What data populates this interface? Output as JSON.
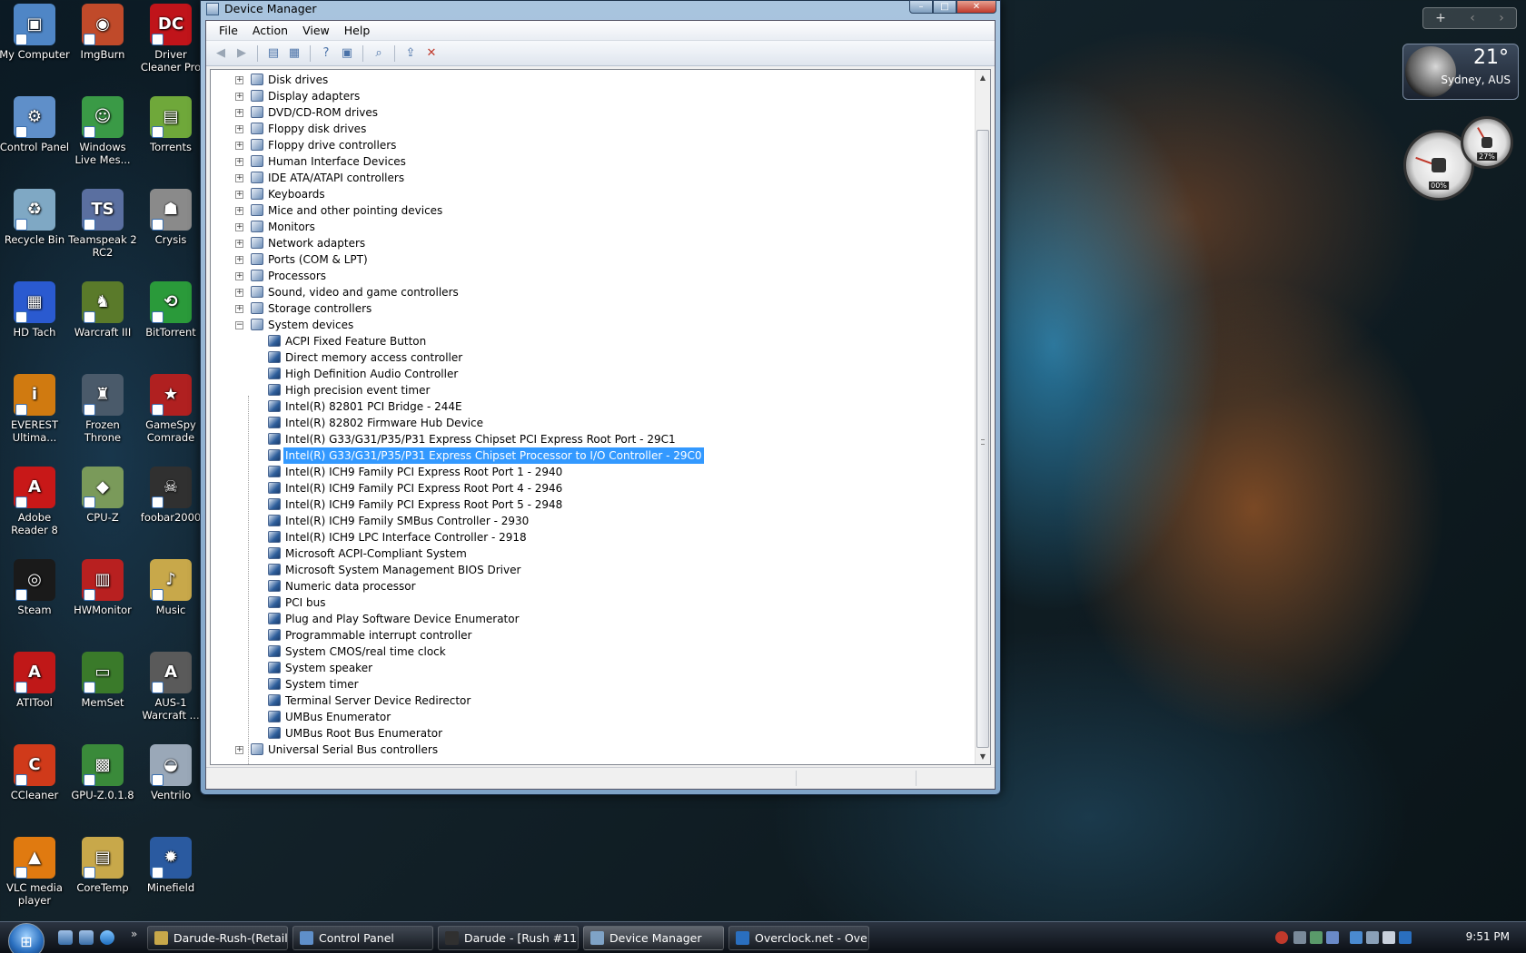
{
  "desktop_icons": [
    {
      "label": "My Computer",
      "color": "#4f86c6",
      "glyph": "▣"
    },
    {
      "label": "ImgBurn",
      "color": "#c04a2a",
      "glyph": "◉"
    },
    {
      "label": "Driver Cleaner Pro",
      "color": "#c0141a",
      "glyph": "DC"
    },
    {
      "label": "Control Panel",
      "color": "#5f8fc9",
      "glyph": "⚙"
    },
    {
      "label": "Windows Live Mes...",
      "color": "#3a9a46",
      "glyph": "☺"
    },
    {
      "label": "Torrents",
      "color": "#6fa83a",
      "glyph": "▤"
    },
    {
      "label": "Recycle Bin",
      "color": "#7fa8c4",
      "glyph": "♻"
    },
    {
      "label": "Teamspeak 2 RC2",
      "color": "#5a6fa0",
      "glyph": "TS"
    },
    {
      "label": "Crysis",
      "color": "#8a8a8a",
      "glyph": "☗"
    },
    {
      "label": "HD Tach",
      "color": "#2a5ad0",
      "glyph": "▦"
    },
    {
      "label": "Warcraft III",
      "color": "#5a7a2a",
      "glyph": "♞"
    },
    {
      "label": "BitTorrent",
      "color": "#2a9a3a",
      "glyph": "⟲"
    },
    {
      "label": "EVEREST Ultima...",
      "color": "#d07a10",
      "glyph": "i"
    },
    {
      "label": "Frozen Throne",
      "color": "#4a5a6a",
      "glyph": "♜"
    },
    {
      "label": "GameSpy Comrade",
      "color": "#b02020",
      "glyph": "★"
    },
    {
      "label": "Adobe Reader 8",
      "color": "#c81818",
      "glyph": "A"
    },
    {
      "label": "CPU-Z",
      "color": "#7a9a5a",
      "glyph": "◆"
    },
    {
      "label": "foobar2000",
      "color": "#303030",
      "glyph": "☠"
    },
    {
      "label": "Steam",
      "color": "#1a1a1a",
      "glyph": "◎"
    },
    {
      "label": "HWMonitor",
      "color": "#b82020",
      "glyph": "▥"
    },
    {
      "label": "Music",
      "color": "#c8a84a",
      "glyph": "♪"
    },
    {
      "label": "ATITool",
      "color": "#c01818",
      "glyph": "A"
    },
    {
      "label": "MemSet",
      "color": "#3a7a2a",
      "glyph": "▭"
    },
    {
      "label": "AUS-1 Warcraft ...",
      "color": "#5a5a5a",
      "glyph": "A"
    },
    {
      "label": "CCleaner",
      "color": "#d03a1a",
      "glyph": "C"
    },
    {
      "label": "GPU-Z.0.1.8",
      "color": "#3a8a3a",
      "glyph": "▩"
    },
    {
      "label": "Ventrilo",
      "color": "#9aa8b8",
      "glyph": "◒"
    },
    {
      "label": "VLC media player",
      "color": "#e07a10",
      "glyph": "▲"
    },
    {
      "label": "CoreTemp",
      "color": "#c8a84a",
      "glyph": "▤"
    },
    {
      "label": "Minefield",
      "color": "#2a5aa0",
      "glyph": "✹"
    }
  ],
  "window": {
    "title": "Device Manager",
    "menu": [
      "File",
      "Action",
      "View",
      "Help"
    ],
    "toolbar_icons": [
      "back-icon",
      "forward-icon",
      "show-hide-console-tree-icon",
      "properties-icon",
      "help-icon",
      "action-pane-icon",
      "scan-hardware-icon",
      "update-driver-icon",
      "uninstall-icon"
    ],
    "tree": [
      {
        "label": "Disk drives",
        "level": 1,
        "expander": "+"
      },
      {
        "label": "Display adapters",
        "level": 1,
        "expander": "+"
      },
      {
        "label": "DVD/CD-ROM drives",
        "level": 1,
        "expander": "+"
      },
      {
        "label": "Floppy disk drives",
        "level": 1,
        "expander": "+"
      },
      {
        "label": "Floppy drive controllers",
        "level": 1,
        "expander": "+"
      },
      {
        "label": "Human Interface Devices",
        "level": 1,
        "expander": "+"
      },
      {
        "label": "IDE ATA/ATAPI controllers",
        "level": 1,
        "expander": "+"
      },
      {
        "label": "Keyboards",
        "level": 1,
        "expander": "+"
      },
      {
        "label": "Mice and other pointing devices",
        "level": 1,
        "expander": "+"
      },
      {
        "label": "Monitors",
        "level": 1,
        "expander": "+"
      },
      {
        "label": "Network adapters",
        "level": 1,
        "expander": "+"
      },
      {
        "label": "Ports (COM & LPT)",
        "level": 1,
        "expander": "+"
      },
      {
        "label": "Processors",
        "level": 1,
        "expander": "+"
      },
      {
        "label": "Sound, video and game controllers",
        "level": 1,
        "expander": "+"
      },
      {
        "label": "Storage controllers",
        "level": 1,
        "expander": "+"
      },
      {
        "label": "System devices",
        "level": 1,
        "expander": "−"
      },
      {
        "label": "ACPI Fixed Feature Button",
        "level": 2
      },
      {
        "label": "Direct memory access controller",
        "level": 2
      },
      {
        "label": "High Definition Audio Controller",
        "level": 2
      },
      {
        "label": "High precision event timer",
        "level": 2
      },
      {
        "label": "Intel(R) 82801 PCI Bridge - 244E",
        "level": 2
      },
      {
        "label": "Intel(R) 82802 Firmware Hub Device",
        "level": 2
      },
      {
        "label": "Intel(R) G33/G31/P35/P31 Express Chipset PCI Express Root Port - 29C1",
        "level": 2
      },
      {
        "label": "Intel(R) G33/G31/P35/P31 Express Chipset Processor to I/O Controller - 29C0",
        "level": 2,
        "selected": true
      },
      {
        "label": "Intel(R) ICH9 Family PCI Express Root Port 1 - 2940",
        "level": 2
      },
      {
        "label": "Intel(R) ICH9 Family PCI Express Root Port 4 - 2946",
        "level": 2
      },
      {
        "label": "Intel(R) ICH9 Family PCI Express Root Port 5 - 2948",
        "level": 2
      },
      {
        "label": "Intel(R) ICH9 Family SMBus Controller - 2930",
        "level": 2
      },
      {
        "label": "Intel(R) ICH9 LPC Interface Controller - 2918",
        "level": 2
      },
      {
        "label": "Microsoft ACPI-Compliant System",
        "level": 2
      },
      {
        "label": "Microsoft System Management BIOS Driver",
        "level": 2
      },
      {
        "label": "Numeric data processor",
        "level": 2
      },
      {
        "label": "PCI bus",
        "level": 2
      },
      {
        "label": "Plug and Play Software Device Enumerator",
        "level": 2
      },
      {
        "label": "Programmable interrupt controller",
        "level": 2
      },
      {
        "label": "System CMOS/real time clock",
        "level": 2
      },
      {
        "label": "System speaker",
        "level": 2
      },
      {
        "label": "System timer",
        "level": 2
      },
      {
        "label": "Terminal Server Device Redirector",
        "level": 2
      },
      {
        "label": "UMBus Enumerator",
        "level": 2
      },
      {
        "label": "UMBus Root Bus Enumerator",
        "level": 2
      },
      {
        "label": "Universal Serial Bus controllers",
        "level": 1,
        "expander": "+"
      }
    ]
  },
  "gadgets": {
    "weather": {
      "temp": "21°",
      "city": "Sydney, AUS"
    },
    "cpu_meter": {
      "cpu": "00%",
      "ram": "27%"
    }
  },
  "taskbar": {
    "buttons": [
      {
        "label": "Darude-Rush-(Retail...",
        "color": "#c8a84a"
      },
      {
        "label": "Control Panel",
        "color": "#5f8fc9"
      },
      {
        "label": "Darude - [Rush #11]...",
        "color": "#303030"
      },
      {
        "label": "Device Manager",
        "color": "#7fa3c7",
        "active": true
      },
      {
        "label": "Overclock.net - Ove...",
        "color": "#2a6fbf"
      }
    ],
    "clock": "9:51 PM"
  }
}
